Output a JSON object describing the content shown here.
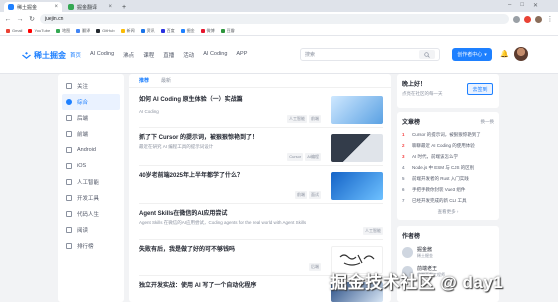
{
  "browser": {
    "tabs": [
      {
        "label": "稀土掘金",
        "active": true,
        "color": "#1e80ff"
      },
      {
        "label": "掘金翻译",
        "active": false,
        "color": "#34a853"
      }
    ],
    "close_glyph": "×",
    "new_tab_glyph": "+",
    "url": "juejin.cn",
    "nav_glyphs": [
      "←",
      "→",
      "↻"
    ],
    "bookmarks": [
      "Gmail",
      "YouTube",
      "地图",
      "翻译",
      "GitHub",
      "新闻",
      "资讯",
      "百度",
      "掘金",
      "微博",
      "豆瓣"
    ]
  },
  "header": {
    "logo": "稀土掘金",
    "nav": [
      {
        "label": "首页",
        "active": true
      },
      {
        "label": "AI Coding",
        "active": false
      },
      {
        "label": "沸点",
        "active": false
      },
      {
        "label": "课程",
        "active": false
      },
      {
        "label": "直播",
        "active": false
      },
      {
        "label": "活动",
        "active": false
      },
      {
        "label": "AI Coding",
        "active": false
      },
      {
        "label": "APP",
        "active": false
      }
    ],
    "search_placeholder": "搜索",
    "search_icon": "search-icon",
    "create_label": "创作者中心",
    "create_caret": "▾",
    "bell_glyph": "🔔"
  },
  "sidebar": {
    "items": [
      {
        "label": "关注",
        "active": false
      },
      {
        "label": "综合",
        "active": true
      },
      {
        "label": "后端",
        "active": false
      },
      {
        "label": "前端",
        "active": false
      },
      {
        "label": "Android",
        "active": false
      },
      {
        "label": "iOS",
        "active": false
      },
      {
        "label": "人工智能",
        "active": false
      },
      {
        "label": "开发工具",
        "active": false
      },
      {
        "label": "代码人生",
        "active": false
      },
      {
        "label": "阅读",
        "active": false
      },
      {
        "label": "排行榜",
        "active": false
      }
    ]
  },
  "feed": {
    "tabs": [
      {
        "label": "推荐",
        "active": true
      },
      {
        "label": "最新",
        "active": false
      }
    ],
    "articles": [
      {
        "title": "如何 AI Coding 原生体验（一）实战篇",
        "desc": "",
        "author": "AI Coding",
        "views": "",
        "likes": "",
        "tags": [
          "人工智能",
          "前端"
        ],
        "thumb": [
          "#cfe8ff",
          "#5aa1e3"
        ]
      },
      {
        "title": "抓了下 Cursor 的提示词，被狠狠惊艳到了！",
        "desc": "最近在研究 AI 编程工具的提示词设计",
        "author": "",
        "views": "",
        "likes": "",
        "tags": [
          "Cursor",
          "AI编程"
        ],
        "thumb": [
          "#333c4a",
          "#e0e4ea"
        ]
      },
      {
        "title": "40岁老前端2025年上半年都学了什么？",
        "desc": "",
        "author": "",
        "views": "",
        "likes": "",
        "tags": [
          "前端",
          "面试"
        ],
        "thumb": [
          "#1463c7",
          "#6ec1ff"
        ]
      },
      {
        "title": "Agent Skills在微信的AI应用尝试",
        "desc": "Agent Skills 在微信的AI应用尝试，Coding agents for the real world with Agent Skills",
        "author": "",
        "views": "",
        "likes": "",
        "tags": [
          "人工智能"
        ],
        "thumb": null
      },
      {
        "title": "失败有后，我是做了好的可不够钱吗",
        "desc": "",
        "author": "",
        "views": "",
        "likes": "",
        "tags": [
          "后端"
        ],
        "thumb": [
          "#ffffff",
          "#ffffff"
        ]
      },
      {
        "title": "独立开发实战：使用 AI 写了一个自动化程序",
        "desc": "",
        "author": "",
        "views": "",
        "likes": "",
        "tags": [
          "AI"
        ],
        "thumb": [
          "#2a4f86",
          "#d8e6f5"
        ]
      }
    ]
  },
  "checkin": {
    "title": "晚上好！",
    "subtitle": "点亮在社区的每一天",
    "button": "去签到"
  },
  "hot": {
    "title": "文章榜",
    "more": "换一换",
    "items": [
      {
        "rank": "1",
        "text": "Cursor 的提示词，被狠狠惊艳到了"
      },
      {
        "rank": "2",
        "text": "聊聊最近 AI Coding 的使用体验"
      },
      {
        "rank": "3",
        "text": "AI 时代，前端该怎么学"
      },
      {
        "rank": "4",
        "text": "Node.js 中 ESM 与 CJS 的区别"
      },
      {
        "rank": "5",
        "text": "前端开发者的 Rust 入门实践"
      },
      {
        "rank": "6",
        "text": "手把手教你封装 Vue3 组件"
      },
      {
        "rank": "7",
        "text": "已经开发完成的新 CLI 工具"
      }
    ],
    "view_more": "查看更多 ›"
  },
  "authors": {
    "title": "作者榜",
    "items": [
      {
        "name": "掘金酱",
        "desc": "稀土掘金"
      },
      {
        "name": "前端老王",
        "desc": "前端开发工程师"
      }
    ]
  },
  "watermark": "掘金技术社区 @ day1"
}
